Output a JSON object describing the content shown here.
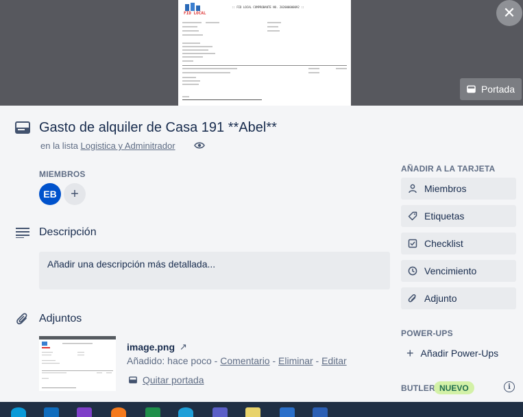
{
  "cover": {
    "doc_brand": "FID LOCAL",
    "doc_header": ":: FID LOCAL COMPROBANTE NO. 202000000092 ::",
    "portada_label": "Portada",
    "close_glyph": "✕"
  },
  "card": {
    "title": "Gasto de alquiler de Casa 191 **Abel**",
    "in_list_prefix": "en la lista",
    "list_name": "Logistica y Adminitrador"
  },
  "members": {
    "label": "MIEMBROS",
    "avatar_initials": "EB",
    "add_glyph": "+",
    "avatar_color": "#0052cc"
  },
  "description": {
    "heading": "Descripción",
    "placeholder": "Añadir una descripción más detallada..."
  },
  "attachments": {
    "heading": "Adjuntos",
    "items": [
      {
        "name": "image.png",
        "arrow": "↗",
        "added": "Añadido: hace poco",
        "sep": " - ",
        "comment": "Comentario",
        "delete": "Eliminar",
        "edit": "Editar",
        "remove_cover": "Quitar portada"
      }
    ]
  },
  "sidebar": {
    "add_to_card_label": "AÑADIR A LA TARJETA",
    "buttons": [
      {
        "label": "Miembros",
        "icon": "person-icon"
      },
      {
        "label": "Etiquetas",
        "icon": "tag-icon"
      },
      {
        "label": "Checklist",
        "icon": "checkbox-icon"
      },
      {
        "label": "Vencimiento",
        "icon": "clock-icon"
      },
      {
        "label": "Adjunto",
        "icon": "paperclip-icon"
      }
    ],
    "powerups_label": "POWER-UPS",
    "add_powerups": "Añadir Power-Ups",
    "butler_label": "BUTLER",
    "butler_badge": "NUEVO",
    "info_glyph": "i"
  },
  "taskbar": {
    "apps": [
      "skype-icon",
      "outlook-icon",
      "visual-studio-icon",
      "firefox-icon",
      "excel-icon",
      "edge-icon",
      "teams-icon",
      "notepad-icon",
      "remote-desktop-icon",
      "word-icon"
    ]
  }
}
